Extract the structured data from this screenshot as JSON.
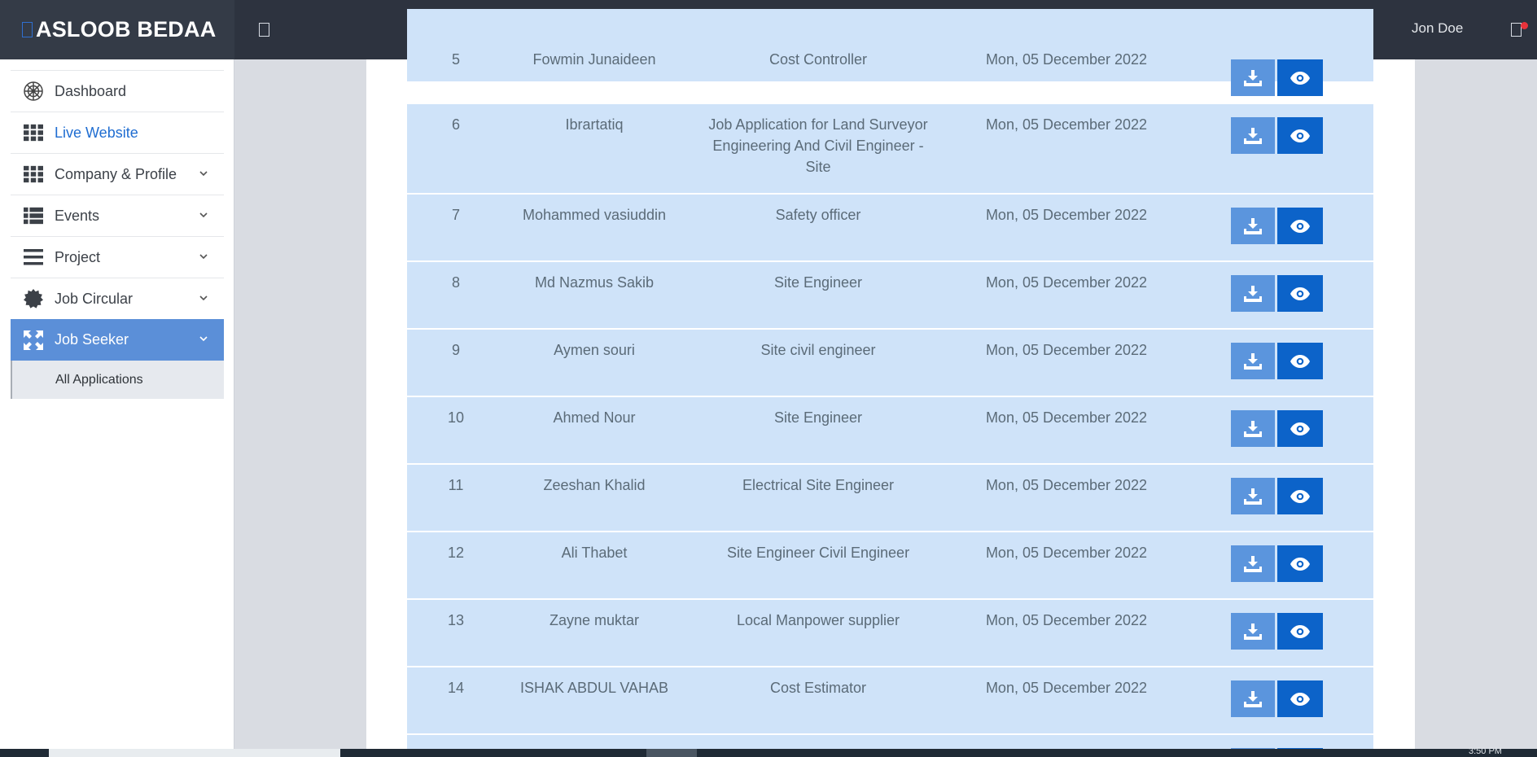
{
  "header": {
    "brand": "ASLOOB BEDAA",
    "user": "Jon Doe"
  },
  "sidebar": {
    "items": [
      {
        "label": "Dashboard",
        "icon": "empire-icon"
      },
      {
        "label": "Live Website",
        "icon": "grid-icon"
      },
      {
        "label": "Company & Profile",
        "icon": "grid-icon"
      },
      {
        "label": "Events",
        "icon": "list-icon"
      },
      {
        "label": "Project",
        "icon": "bars-icon"
      },
      {
        "label": "Job Circular",
        "icon": "badge-icon"
      },
      {
        "label": "Job Seeker",
        "icon": "expand-icon"
      }
    ],
    "sub_item": "All Applications"
  },
  "table": {
    "rows": [
      {
        "num": "5",
        "name": "Fowmin Junaideen",
        "title": "Cost Controller",
        "date": "Mon, 05 December 2022"
      },
      {
        "num": "6",
        "name": "Ibrartatiq",
        "title": "Job Application for Land Surveyor Engineering And Civil Engineer - Site",
        "date": "Mon, 05 December 2022"
      },
      {
        "num": "7",
        "name": "Mohammed vasiuddin",
        "title": "Safety officer",
        "date": "Mon, 05 December 2022"
      },
      {
        "num": "8",
        "name": "Md Nazmus Sakib",
        "title": "Site Engineer",
        "date": "Mon, 05 December 2022"
      },
      {
        "num": "9",
        "name": "Aymen souri",
        "title": "Site civil engineer",
        "date": "Mon, 05 December 2022"
      },
      {
        "num": "10",
        "name": "Ahmed Nour",
        "title": "Site Engineer",
        "date": "Mon, 05 December 2022"
      },
      {
        "num": "11",
        "name": "Zeeshan Khalid",
        "title": "Electrical Site Engineer",
        "date": "Mon, 05 December 2022"
      },
      {
        "num": "12",
        "name": "Ali Thabet",
        "title": "Site Engineer Civil Engineer",
        "date": "Mon, 05 December 2022"
      },
      {
        "num": "13",
        "name": "Zayne muktar",
        "title": "Local Manpower supplier",
        "date": "Mon, 05 December 2022"
      },
      {
        "num": "14",
        "name": "ISHAK ABDUL VAHAB",
        "title": "Cost Estimator",
        "date": "Mon, 05 December 2022"
      }
    ]
  },
  "taskbar": {
    "clock": "3:50 PM"
  }
}
